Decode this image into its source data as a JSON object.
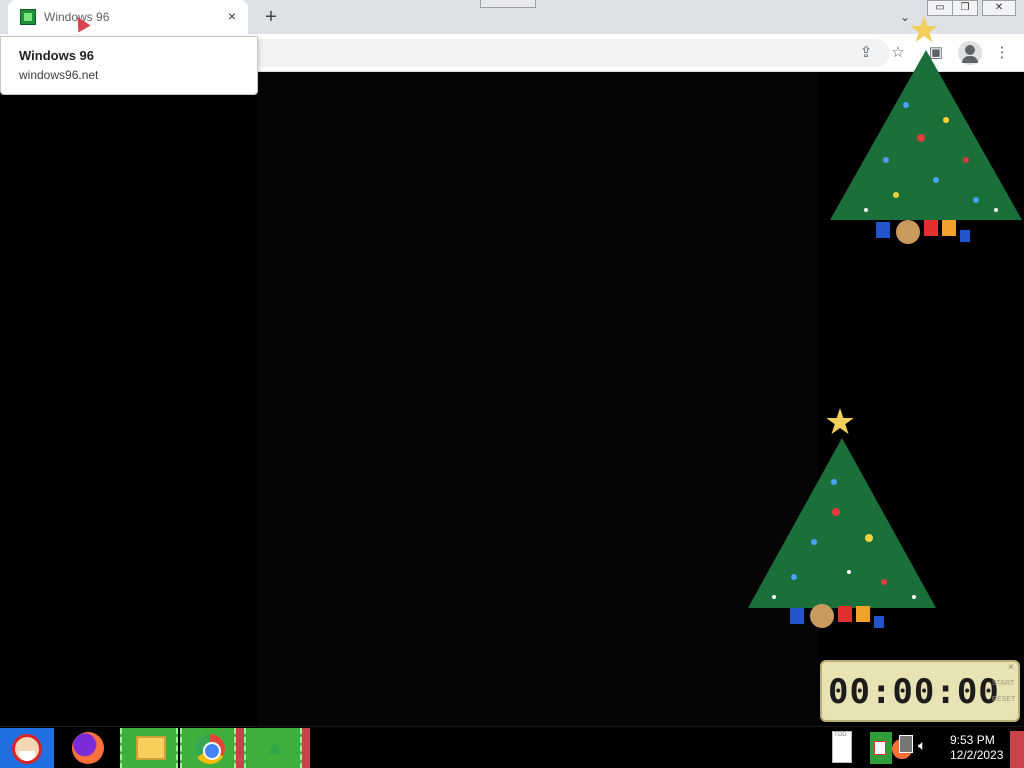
{
  "browser": {
    "tab": {
      "title": "Windows 96",
      "close_glyph": "×"
    },
    "new_tab_glyph": "+",
    "tab_search_glyph": "⌄",
    "window_controls": {
      "minimize": "▭",
      "maximize": "❐",
      "close": "✕"
    },
    "toolbar_icons": {
      "share": "⇪",
      "star": "☆",
      "extensions": "▣",
      "menu": "⋮"
    }
  },
  "hover_card": {
    "title": "Windows 96",
    "url": "windows96.net"
  },
  "timer": {
    "display": "00:00:00",
    "start_label": "START",
    "reset_label": "RESET",
    "close_glyph": "×"
  },
  "taskbar": {
    "clock_time": "9:53 PM",
    "clock_date": "12/2/2023",
    "doc_label": "TOD"
  },
  "colors": {
    "desktop": "#000000",
    "taskbar_task": "#3fae3a",
    "tree": "#1b6f3a",
    "star": "#f2cf5a"
  }
}
